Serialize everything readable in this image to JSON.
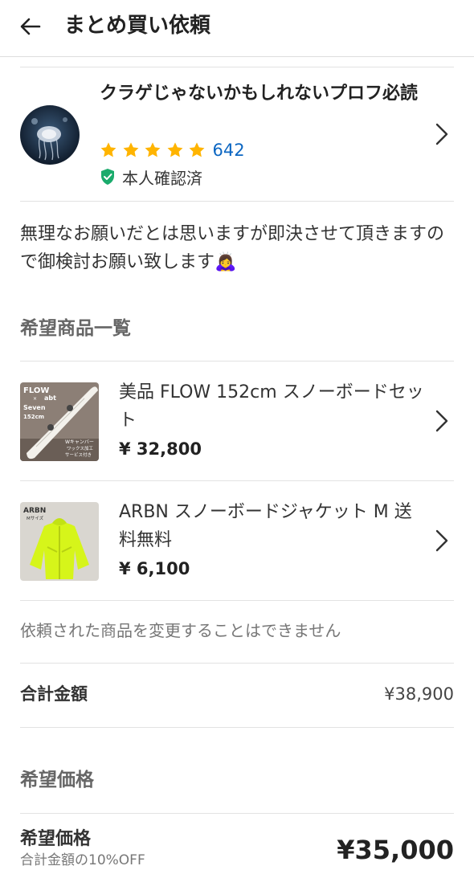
{
  "header": {
    "title": "まとめ買い依頼",
    "back_icon": "arrow-left-icon"
  },
  "seller": {
    "name": "クラゲじゃないかもしれないプロフ必読",
    "rating_stars": 5,
    "rating_count": "642",
    "verified_label": "本人確認済",
    "star_color": "#ffb400",
    "verified_color": "#1aab6c"
  },
  "message": "無理なお願いだとは思いますが即決させて頂きますので御検討お願い致します🙇‍♀️",
  "products_section": {
    "title": "希望商品一覧",
    "items": [
      {
        "title": "美品 FLOW 152cm スノーボードセット",
        "price": "¥ 32,800",
        "thumb_text": [
          "FLOW",
          "×",
          "abt",
          "Seven",
          "152cm",
          "Wキャンバー",
          "ワックス加工",
          "サービス付き"
        ]
      },
      {
        "title": "ARBN スノーボードジャケット M 送料無料",
        "price": "¥ 6,100",
        "thumb_text": [
          "ARBN",
          "Mサイズ"
        ]
      }
    ],
    "note": "依頼された商品を変更することはできません"
  },
  "total": {
    "label": "合計金額",
    "value": "¥38,900"
  },
  "desired_section": {
    "title": "希望価格",
    "label": "希望価格",
    "sub": "合計金額の10%OFF",
    "value": "¥35,000"
  }
}
